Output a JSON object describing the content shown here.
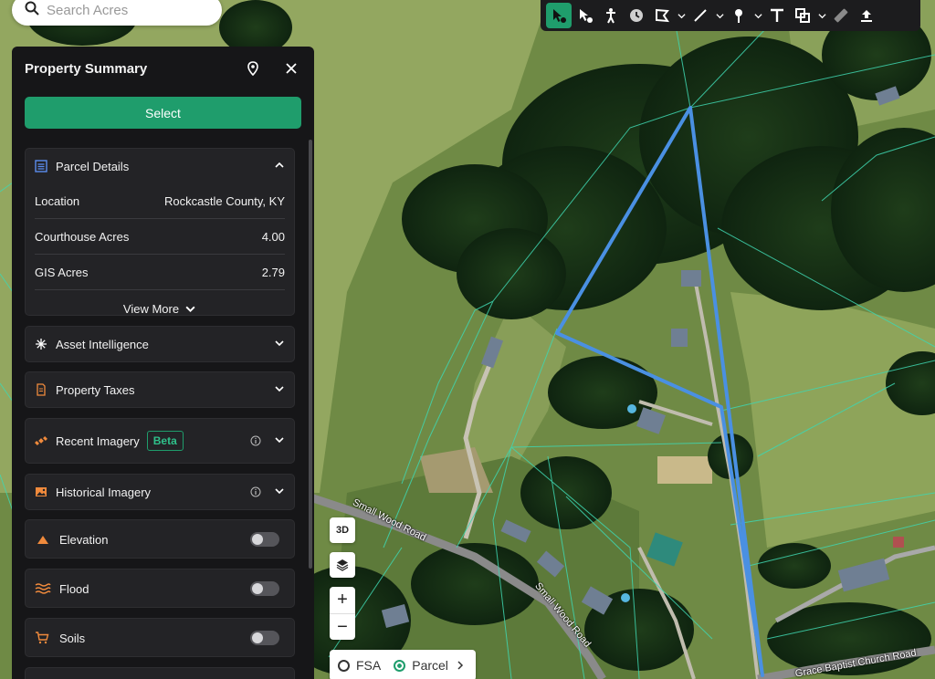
{
  "search": {
    "placeholder": "Search Acres"
  },
  "toolbar": {
    "tools": [
      "select-tool",
      "point-select-tool",
      "person-tool",
      "clock-tool",
      "polygon-tool",
      "line-tool",
      "pin-tool",
      "text-tool",
      "shape-tool",
      "ruler-tool",
      "upload-tool"
    ]
  },
  "panel": {
    "title": "Property Summary",
    "select_label": "Select",
    "parcel": {
      "title": "Parcel Details",
      "rows": [
        {
          "label": "Location",
          "value": "Rockcastle County, KY"
        },
        {
          "label": "Courthouse Acres",
          "value": "4.00"
        },
        {
          "label": "GIS Acres",
          "value": "2.79"
        }
      ],
      "view_more": "View More"
    },
    "sections": {
      "asset": "Asset Intelligence",
      "taxes": "Property Taxes",
      "recent": "Recent Imagery",
      "beta": "Beta",
      "historical": "Historical Imagery",
      "elevation": "Elevation",
      "flood": "Flood",
      "soils": "Soils"
    }
  },
  "map": {
    "btn_3d": "3D",
    "layers": {
      "fsa": "FSA",
      "parcel": "Parcel",
      "selected": "Parcel"
    },
    "roads": {
      "small_wood_1": "Small Wood Road",
      "small_wood_2": "Small Wood Road",
      "grace_baptist": "Grace Baptist Church Road"
    }
  },
  "colors": {
    "accent": "#1f9d6c",
    "parcel_outline": "#4a90e2",
    "parcel_lines": "#3fd6b0"
  }
}
